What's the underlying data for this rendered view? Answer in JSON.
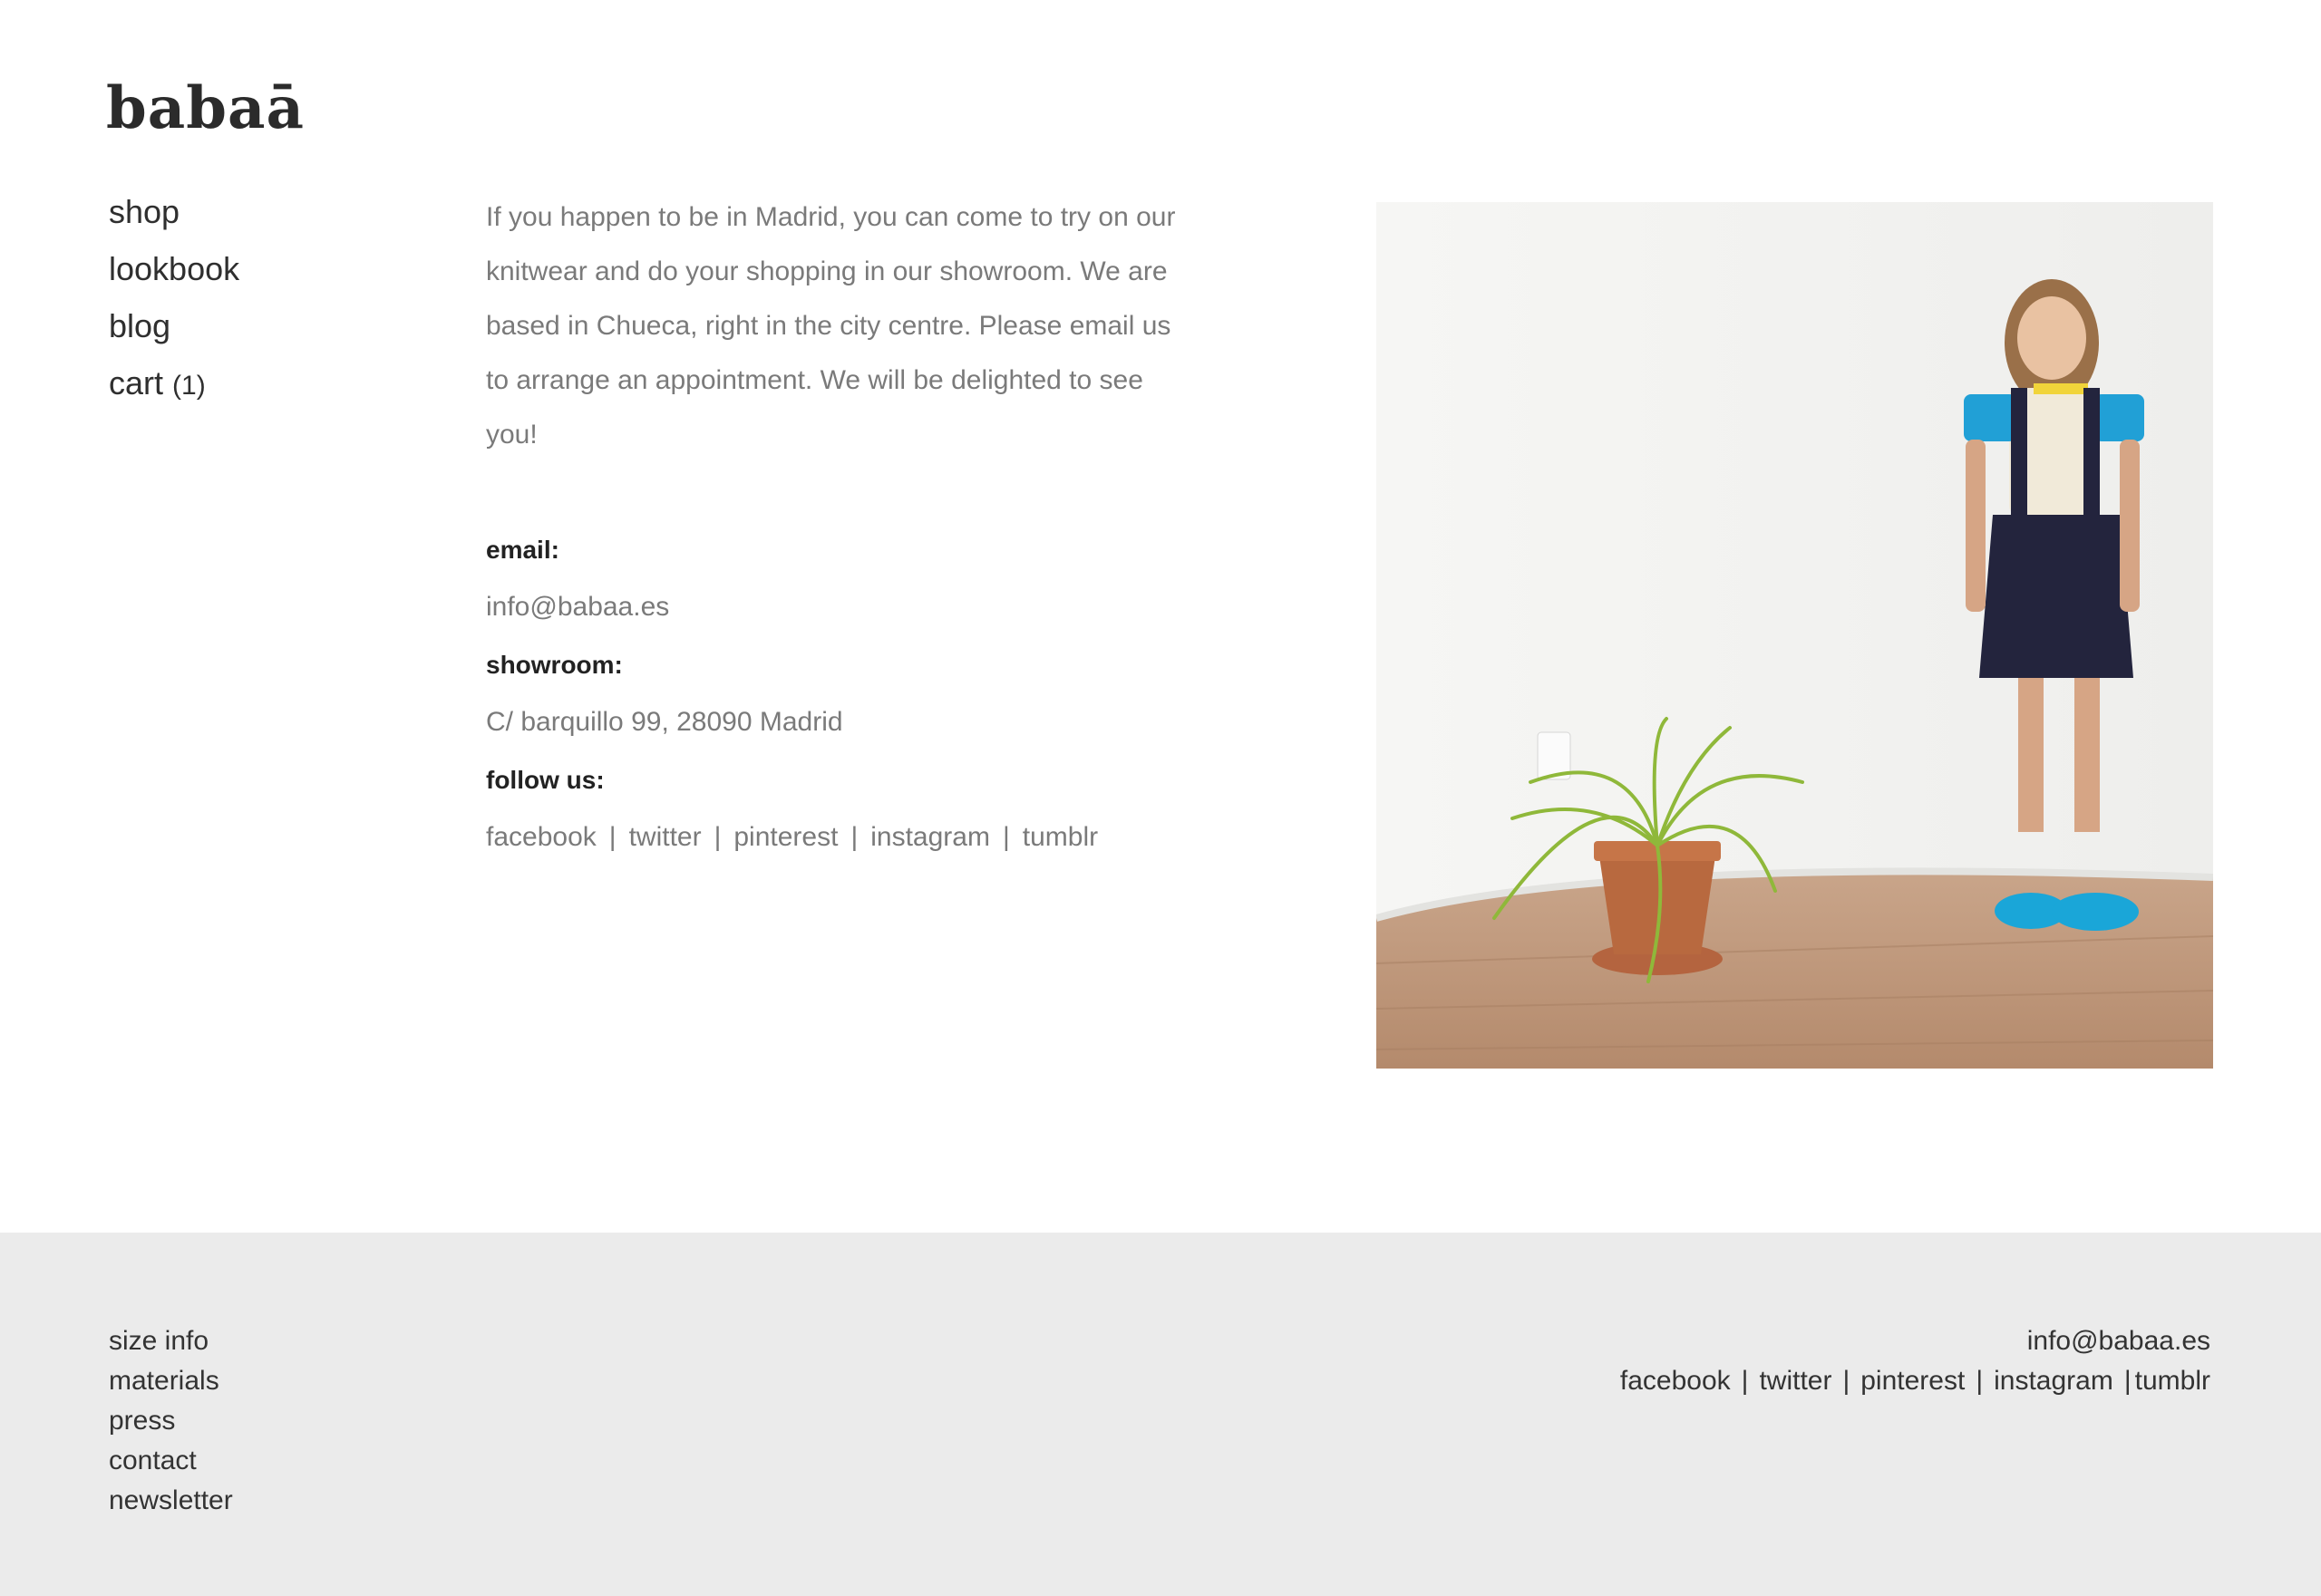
{
  "brand": {
    "logo_text": "babaā"
  },
  "nav": {
    "items": [
      {
        "label": "shop"
      },
      {
        "label": "lookbook"
      },
      {
        "label": "blog"
      },
      {
        "label": "cart",
        "count": "(1)"
      }
    ]
  },
  "main": {
    "intro": "If you happen to be in Madrid, you can come to try on our knitwear and do your shopping in our showroom. We are based in Chueca, right in the city centre. Please email us to arrange an appointment. We will be delighted to see you!",
    "email_label": "email:",
    "email_value": "info@babaa.es",
    "showroom_label": "showroom:",
    "showroom_value": "C/ barquillo 99, 28090 Madrid",
    "follow_label": "follow us:",
    "social": [
      "facebook",
      "twitter",
      "pinterest",
      "instagram",
      "tumblr"
    ],
    "separator": "|"
  },
  "footer": {
    "links": [
      "size info",
      "materials",
      "press",
      "contact",
      "newsletter"
    ],
    "email": "info@babaa.es",
    "social": [
      "facebook",
      "twitter",
      "pinterest",
      "instagram",
      "tumblr"
    ],
    "separator": "|"
  },
  "colors": {
    "footer_bg": "#ebebeb",
    "body_text_grey": "#7a7a7a",
    "heading_text": "#222222"
  }
}
